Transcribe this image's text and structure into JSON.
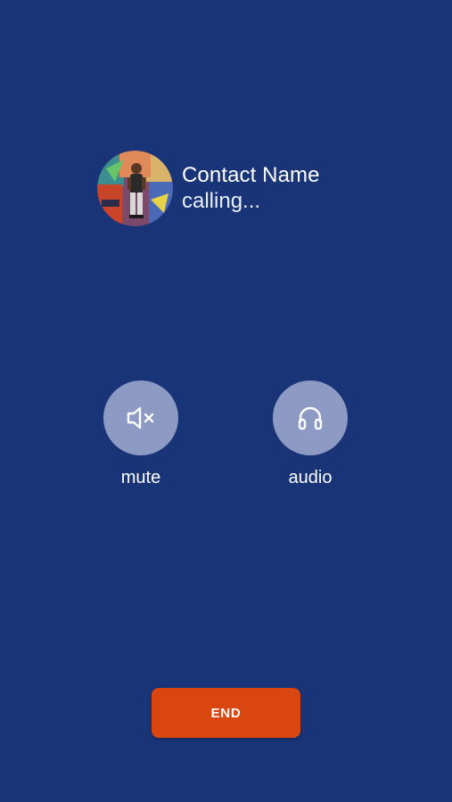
{
  "colors": {
    "background": "#193578",
    "control_button": "#8d9ac3",
    "end_button": "#d9460f",
    "text": "#ffffff"
  },
  "contact": {
    "name": "Contact Name",
    "status": "calling..."
  },
  "controls": {
    "mute": {
      "label": "mute",
      "icon": "speaker-muted-icon"
    },
    "audio": {
      "label": "audio",
      "icon": "headphones-icon"
    }
  },
  "actions": {
    "end_label": "END"
  }
}
